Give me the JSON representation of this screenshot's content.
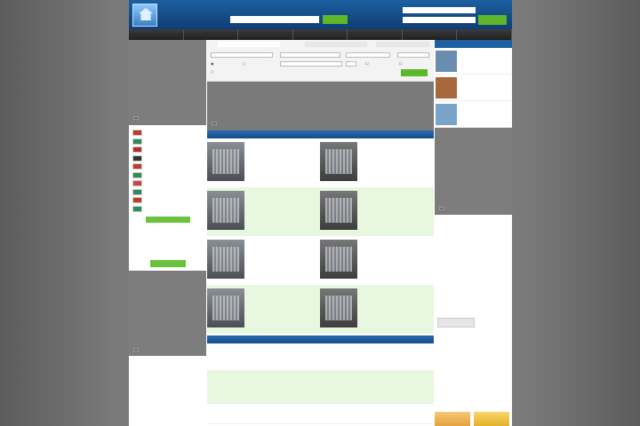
{
  "header": {
    "logo_line1": "",
    "logo_line2": "",
    "search_label": "",
    "search_placeholder": "",
    "search_button": "",
    "login_label": "",
    "password_label": "",
    "login_button": ""
  },
  "nav": {
    "items": [
      "",
      "",
      "",
      "",
      "",
      "",
      ""
    ]
  },
  "left": {
    "sidebar_title": "",
    "languages": [
      {
        "label": "",
        "flag": "#c0392b"
      },
      {
        "label": "",
        "flag": "#2e8b57"
      },
      {
        "label": "",
        "flag": "#b03030"
      },
      {
        "label": "",
        "flag": "#333333"
      },
      {
        "label": "",
        "flag": "#c0392b"
      },
      {
        "label": "",
        "flag": "#2e8b57"
      },
      {
        "label": "",
        "flag": "#d04040"
      },
      {
        "label": "",
        "flag": "#2e8b57"
      },
      {
        "label": "",
        "flag": "#c0392b"
      },
      {
        "label": "",
        "flag": "#2e8b57"
      }
    ],
    "lang_button": "",
    "sub_title": "",
    "sub_items": [
      "",
      "",
      ""
    ],
    "sub_button": "",
    "bottom_label": ""
  },
  "filter": {
    "tabs": [
      "",
      "",
      ""
    ],
    "button": ""
  },
  "banner": {
    "label": ""
  },
  "listings": {
    "section_title": "",
    "rows": [
      [
        {
          "l1": "",
          "l2": "",
          "l3": "",
          "l4": ""
        },
        {
          "l1": "",
          "l2": "",
          "l3": "",
          "l4": ""
        }
      ],
      [
        {
          "l1": "",
          "l2": "",
          "l3": "",
          "l4": ""
        },
        {
          "l1": "",
          "l2": "",
          "l3": "",
          "l4": ""
        }
      ],
      [
        {
          "l1": "",
          "l2": "",
          "l3": "",
          "l4": ""
        },
        {
          "l1": "",
          "l2": "",
          "l3": "",
          "l4": ""
        }
      ],
      [
        {
          "l1": "",
          "l2": "",
          "l3": "",
          "l4": ""
        },
        {
          "l1": "",
          "l2": "",
          "l3": "",
          "l4": ""
        }
      ]
    ]
  },
  "news": {
    "section_title": "",
    "items": [
      {
        "meta": "",
        "title": "",
        "text": ""
      },
      {
        "meta": "",
        "title": "",
        "text": ""
      },
      {
        "meta": "",
        "title": "",
        "text": ""
      }
    ]
  },
  "right": {
    "header": "",
    "items": [
      {
        "label": "",
        "color": "#6a8caf"
      },
      {
        "label": "",
        "color": "#a9683c"
      },
      {
        "label": "",
        "color": "#7aa3c8"
      }
    ],
    "gray_label": "",
    "news_title": "",
    "news": [
      {
        "title": "",
        "text": ""
      },
      {
        "title": "",
        "text": ""
      },
      {
        "title": "",
        "text": ""
      }
    ],
    "news_button": ""
  },
  "colors": {
    "header_blue": "#1d5fa0",
    "accent_green": "#5cb82a",
    "row_alt": "#e8f8e0",
    "link": "#2266bb"
  }
}
